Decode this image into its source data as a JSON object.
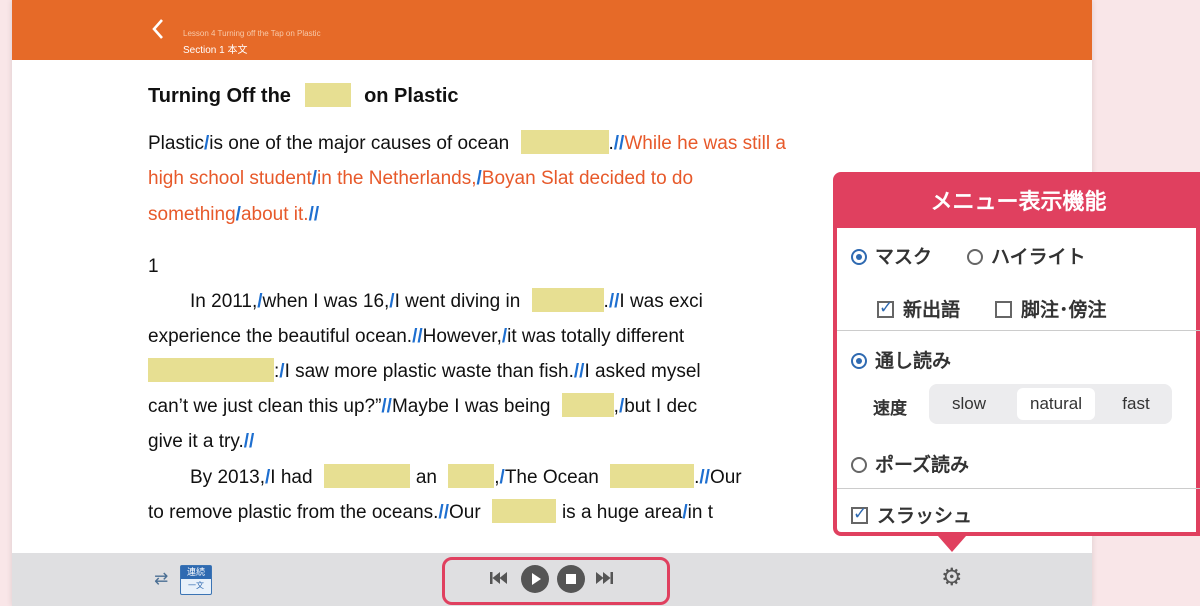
{
  "header": {
    "lesson": "Lesson 4 Turning off the Tap on Plastic",
    "section": "Section 1 本文"
  },
  "text": {
    "title_a": "Turning Off the",
    "title_b": "on Plastic",
    "l1_a": "Plastic",
    "l1_b": "is one of the major causes of ocean",
    "l1_c": ".",
    "l1_d": "While he was still a",
    "l2_a": "high school student",
    "l2_b": "in the Netherlands,",
    "l2_c": "Boyan Slat decided to do",
    "l3_a": "something",
    "l3_b": "about it.",
    "para_num": "1",
    "l4_a": "In 2011,",
    "l4_b": "when I was 16,",
    "l4_c": "I went diving in",
    "l4_d": ".",
    "l4_e": "I was exci",
    "l5_a": "experience the beautiful ocean.",
    "l5_b": "However,",
    "l5_c": "it was totally different",
    "l6_a": ":",
    "l6_b": "I saw more plastic waste than fish.",
    "l6_c": "I asked mysel",
    "l7_a": "can’t we just clean this up?”",
    "l7_b": "Maybe I was being",
    "l7_c": ",",
    "l7_d": "but I dec",
    "l8_a": "give it a try.",
    "l9_a": "By 2013,",
    "l9_b": "I had",
    "l9_c": "an",
    "l9_d": ",",
    "l9_e": "The Ocean",
    "l9_f": ".",
    "l9_g": "Our",
    "l10_a": "to remove plastic from the oceans.",
    "l10_b": "Our",
    "l10_c": "is a huge area",
    "l10_d": "in t"
  },
  "slash_single": "/",
  "slash_double": "//",
  "footer": {
    "renzoku_top": "連続",
    "renzoku_bottom": "一文"
  },
  "menu": {
    "title": "メニュー表示機能",
    "mask_label": "マスク",
    "highlight_label": "ハイライト",
    "new_words_label": "新出語",
    "footnote_label": "脚注･傍注",
    "read_through_label": "通し読み",
    "speed_label": "速度",
    "speed_options": [
      "slow",
      "natural",
      "fast"
    ],
    "pause_read_label": "ポーズ読み",
    "slash_label": "スラッシュ",
    "selected_mode": "マスク",
    "selected_read": "通し読み",
    "selected_speed": "natural"
  },
  "colors": {
    "header": "#e66a28",
    "accent": "#e0405f",
    "mask": "#e7df92",
    "slash": "#1e6fd0",
    "orange_text": "#e7592a"
  }
}
